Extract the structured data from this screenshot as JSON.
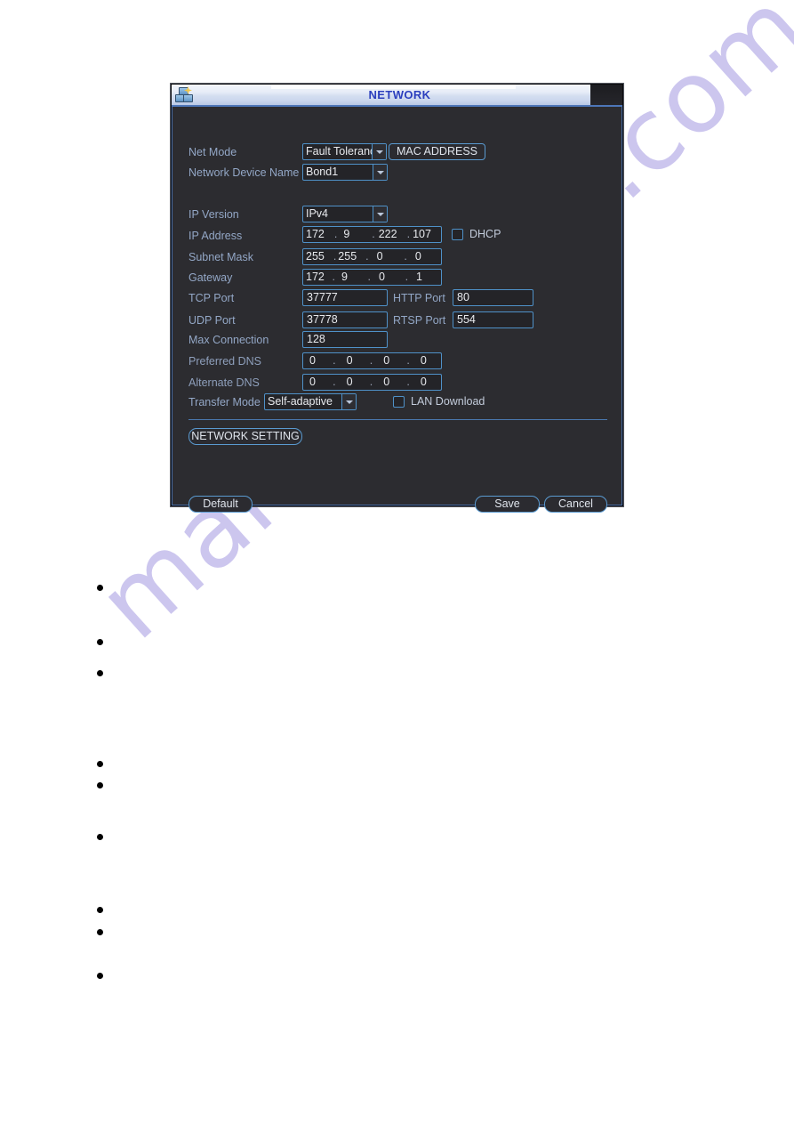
{
  "window": {
    "title": "NETWORK",
    "icon": "network-computers-icon"
  },
  "fields": {
    "net_mode": {
      "label": "Net Mode",
      "value": "Fault Tolerance",
      "display": "Fault Toleranc"
    },
    "mac_address_button": "MAC ADDRESS",
    "network_device_name": {
      "label": "Network Device Name",
      "value": "Bond1"
    },
    "ip_version": {
      "label": "IP Version",
      "value": "IPv4"
    },
    "ip_address": {
      "label": "IP Address",
      "octets": [
        "172",
        "9",
        "222",
        "107"
      ]
    },
    "dhcp": {
      "label": "DHCP",
      "checked": false
    },
    "subnet_mask": {
      "label": "Subnet Mask",
      "octets": [
        "255",
        "255",
        "0",
        "0"
      ]
    },
    "gateway": {
      "label": "Gateway",
      "octets": [
        "172",
        "9",
        "0",
        "1"
      ]
    },
    "tcp_port": {
      "label": "TCP Port",
      "value": "37777"
    },
    "http_port": {
      "label": "HTTP Port",
      "value": "80"
    },
    "udp_port": {
      "label": "UDP Port",
      "value": "37778"
    },
    "rtsp_port": {
      "label": "RTSP Port",
      "value": "554"
    },
    "max_connection": {
      "label": "Max Connection",
      "value": "128"
    },
    "preferred_dns": {
      "label": "Preferred DNS",
      "octets": [
        "0",
        "0",
        "0",
        "0"
      ]
    },
    "alternate_dns": {
      "label": "Alternate DNS",
      "octets": [
        "0",
        "0",
        "0",
        "0"
      ]
    },
    "transfer_mode": {
      "label": "Transfer Mode",
      "value": "Self-adaptive"
    },
    "lan_download": {
      "label": "LAN Download",
      "checked": false
    }
  },
  "buttons": {
    "network_setting": "NETWORK SETTING",
    "default": "Default",
    "save": "Save",
    "cancel": "Cancel"
  },
  "watermark": {
    "text": "manualshive.com",
    "color": "#c9c3ee"
  },
  "colors": {
    "dialog_bg": "#2c2c30",
    "label": "#93a7c6",
    "input_border": "#4f91c8",
    "title_text": "#2b3fbe"
  }
}
